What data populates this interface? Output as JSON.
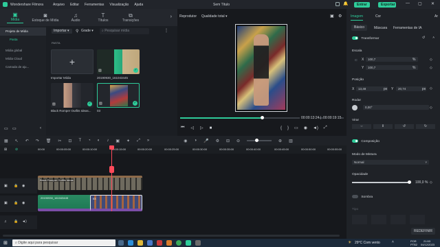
{
  "app": {
    "name": "Wondershare Filmora",
    "menu": [
      "Arquivo",
      "Editar",
      "Ferramentas",
      "Visualização",
      "Ajuda"
    ],
    "doc_title": "Sem Título",
    "login_label": "Entrar",
    "export_label": "Exportar"
  },
  "top_tabs": [
    {
      "label": "Mídia",
      "icon": "folder-icon"
    },
    {
      "label": "Estoque de Mídia",
      "icon": "film-icon"
    },
    {
      "label": "Áudio",
      "icon": "music-icon"
    },
    {
      "label": "Títulos",
      "icon": "text-icon"
    },
    {
      "label": "Transições",
      "icon": "transition-icon"
    }
  ],
  "left_nav": {
    "items": [
      "Projeto de Mídia",
      "Pasta",
      "Mídia global",
      "Mídia Cloud",
      "Camada de aju..."
    ]
  },
  "media": {
    "import_label": "Importar",
    "grid_label": "Grade",
    "search_placeholder": "Pesquisar mídia",
    "section": "PASTA",
    "items": [
      {
        "caption": "Importar Mídia"
      },
      {
        "caption": "20190930_161043445"
      },
      {
        "caption": "Black Romper Outfits Ideas..."
      },
      {
        "caption": "03"
      }
    ]
  },
  "player": {
    "tab_label": "Reprodutor",
    "quality_label": "Qualidade total",
    "current_time": "00:00:13:24",
    "total_time": "00:00:19:15",
    "progress": 0.72
  },
  "props": {
    "tabs": [
      "Imagem",
      "Cor",
      "Ar"
    ],
    "subtabs": [
      "Básico",
      "Máscara",
      "Ferramentas de IA"
    ],
    "transform_label": "Transformar",
    "scale_label": "Escala",
    "scale_x": "100,7",
    "scale_y": "100,7",
    "position_label": "Posição",
    "pos_x": "13,48",
    "pos_y": "20,74",
    "unit_px": "px",
    "unit_pct": "%",
    "rotate_label": "Rodar",
    "rotate_value": "0,00°",
    "flip_label": "Virar",
    "composition_label": "Composição",
    "blend_label": "Modo de Mistura",
    "blend_value": "Normal",
    "opacity_label": "Opacidade",
    "opacity_value": "100,0",
    "shadow_label": "Sombra",
    "type_label": "Tipo",
    "reset_label": "REDEFINIR",
    "accent": "#2ecc9a"
  },
  "timeline": {
    "ruler": [
      "00:00",
      "00:00:05:00",
      "00:00:10:00",
      "00:00:15:00",
      "00:00:20:00",
      "00:00:25:00",
      "00:00:30:00",
      "00:00:35:00",
      "00:00:40:00",
      "00:00:45:00",
      "00:00:50:00",
      "00:00:55:00"
    ],
    "clip_top_label": "Black Romper Outfits Ideas",
    "clip_mid_label": "20190930_161043445",
    "clip_end_label": "03"
  },
  "taskbar": {
    "search_placeholder": "Digite aqui para pesquisar",
    "weather": "29°C  Com vento",
    "lang": "POR",
    "layout": "PTB2",
    "time": "21:53",
    "date": "04/12/2023"
  }
}
